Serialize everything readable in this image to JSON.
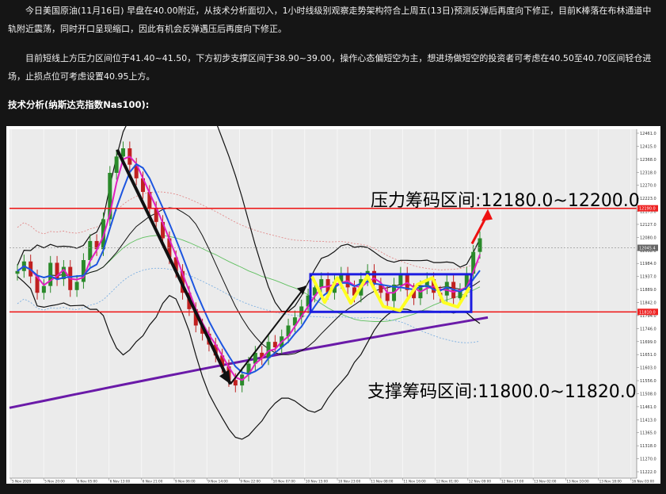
{
  "article": {
    "p1": "今日美国原油(11月16日) 早盘在40.00附近，从技术分析面切入，1小时线级别观察走势架构符合上周五(13日)预测反弹后再度向下修正，目前K棒落在布林通道中轨附近震荡，同时开口呈现缩口，因此有机会反弹遇压后再度向下修正。",
    "p2": "目前短线上方压力区间位于41.40~41.50，下方初步支撑区间于38.90~39.00，操作心态偏短空为主，想进场做短空的投资者可考虑在40.50至40.70区间轻仓进场，止损点位可考虑设置40.95上方。",
    "section_title": "技术分析(纳斯达克指数Nas100):"
  },
  "chart_data": {
    "type": "line",
    "title": "",
    "xlabel": "",
    "ylabel": "",
    "x_ticks": [
      "5 Nov 2020",
      "5 Nov 20:00",
      "6 Nov 05:00",
      "6 Nov 13:00",
      "6 Nov 21:00",
      "9 Nov 06:00",
      "9 Nov 14:00",
      "9 Nov 22:00",
      "10 Nov 07:00",
      "10 Nov 15:00",
      "10 Nov 23:00",
      "11 Nov 08:00",
      "11 Nov 16:00",
      "12 Nov 01:00",
      "12 Nov 09:00",
      "12 Nov 17:00",
      "13 Nov 02:00",
      "13 Nov 10:00",
      "13 Nov 18:00",
      "16 Nov 03:00"
    ],
    "y_ticks": [
      "12461.0",
      "12415.0",
      "12368.0",
      "12318.0",
      "12270.0",
      "12223.0",
      "12175.0",
      "12127.0",
      "12080.0",
      "12032.0",
      "11984.0",
      "11937.0",
      "11889.0",
      "11842.0",
      "11794.0",
      "11746.0",
      "11699.0",
      "11651.0",
      "11603.0",
      "11556.0",
      "11508.0",
      "11461.0",
      "11413.0",
      "11365.0",
      "11318.0",
      "11270.0",
      "11222.0"
    ],
    "ylim": [
      11200,
      12480
    ],
    "resistance_label": "压力筹码区间:12180.0~12200.0",
    "support_label": "支撑筹码区间:11800.0~11820.0",
    "resistance_level": 12190,
    "support_level": 11810,
    "price_tag_resistance": "12190.0",
    "price_tag_support": "11810.0",
    "price_tag_current": "12045.4",
    "close": [
      11960,
      11995,
      11940,
      11880,
      11905,
      11990,
      11930,
      11975,
      11890,
      11920,
      12000,
      12070,
      12040,
      12150,
      12320,
      12380,
      12410,
      12350,
      12300,
      12250,
      12190,
      12140,
      12080,
      12010,
      11960,
      11880,
      11820,
      11760,
      11730,
      11690,
      11650,
      11610,
      11560,
      11540,
      11580,
      11620,
      11660,
      11640,
      11700,
      11680,
      11720,
      11760,
      11790,
      11830,
      11870,
      11900,
      11930,
      11880,
      11920,
      11950,
      11900,
      11870,
      11930,
      11960,
      11910,
      11880,
      11850,
      11910,
      11950,
      11890,
      11860,
      11900,
      11930,
      11880,
      11870,
      11920,
      11860,
      11890,
      11950,
      12030,
      12080
    ],
    "colors": {
      "resistance_line": "#ee1111",
      "support_line": "#ee1111",
      "box": "#1c1ce0",
      "zigzag": "#ffff22",
      "trend_arrow": "#111111",
      "breakout_arrow": "#ee1111",
      "long_ma": "#6a1aa8",
      "bollinger": "#111111",
      "ma_fast": "#e020c0",
      "ma_mid": "#1c55e0",
      "candle_up": "#2a8a2a",
      "candle_down": "#c02020"
    }
  }
}
